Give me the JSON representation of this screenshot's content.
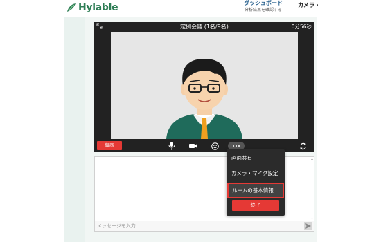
{
  "header": {
    "logo_text": "Hylable",
    "dashboard_title": "ダッシュボード",
    "dashboard_subtitle": "分析結果を確認する",
    "camera_link": "カメラ・"
  },
  "video": {
    "title": "定例会議 (1名/9名)",
    "timer": "0分56秒",
    "record_label": "録画",
    "icons": {
      "expand": "expand-icon",
      "mic": "microphone-icon",
      "camera": "video-camera-icon",
      "emoji": "emoji-icon",
      "more": "more-options-icon",
      "switch": "switch-camera-icon"
    }
  },
  "menu": {
    "items": [
      "画面共有",
      "カメラ・マイク設定",
      "ルームの基本情報"
    ],
    "end_label": "終了"
  },
  "chat": {
    "placeholder": "メッセージを入力",
    "send_icon": "send-icon"
  },
  "colors": {
    "brand_green": "#2e7d55",
    "accent_red": "#e53935",
    "video_bg": "#222222"
  }
}
